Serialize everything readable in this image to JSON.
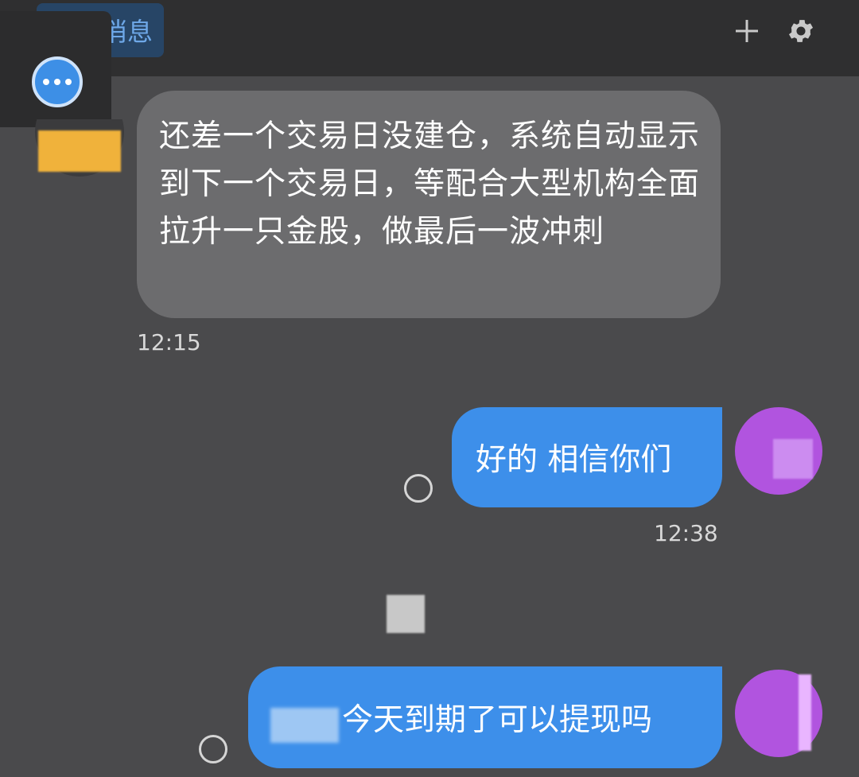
{
  "header": {
    "tab_label": "消息",
    "icons": {
      "add": "plus-icon",
      "settings": "gear-icon",
      "more": "more-horizontal-icon"
    }
  },
  "messages": [
    {
      "direction": "incoming",
      "text": "还差一个交易日没建仓，系统自动显示到下一个交易日，等配合大型机构全面拉升一只金股，做最后一波冲刺",
      "time": "12:15"
    },
    {
      "direction": "outgoing",
      "text": "好的 相信你们",
      "time": "12:38"
    },
    {
      "direction": "outgoing",
      "text": "今天到期了可以提现吗"
    }
  ],
  "colors": {
    "background": "#4a4a4c",
    "incoming_bubble": "#6c6c6e",
    "outgoing_bubble": "#3d8fea",
    "accent": "#3d8fe6"
  }
}
